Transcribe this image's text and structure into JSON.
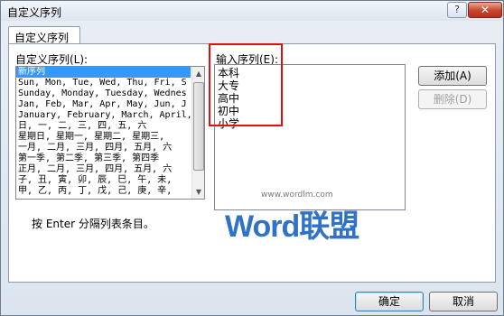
{
  "window": {
    "title": "自定义序列",
    "help_label": "?",
    "close_label": "✕"
  },
  "tab": {
    "label": "自定义序列"
  },
  "custom_list": {
    "label": "自定义序列(L):",
    "items": [
      "新序列",
      "Sun, Mon, Tue, Wed, Thu, Fri, S",
      "Sunday, Monday, Tuesday, Wednes",
      "Jan, Feb, Mar, Apr, May, Jun, J",
      "January, February, March, April,",
      "日, 一, 二, 三, 四, 五, 六",
      "星期日, 星期一, 星期二, 星期三,",
      "一月, 二月, 三月, 四月, 五月, 六",
      "第一季, 第二季, 第三季, 第四季",
      "正月, 二月, 三月, 四月, 五月, 六",
      "子, 丑, 寅, 卯, 辰, 巳, 午, 未,",
      "甲, 乙, 丙, 丁, 戊, 己, 庚, 辛,"
    ],
    "selected_index": 0
  },
  "input_entries": {
    "label": "输入序列(E):",
    "lines": [
      "本科",
      "大专",
      "高中",
      "初中",
      "小学"
    ]
  },
  "buttons": {
    "add": "添加(A)",
    "delete": "删除(D)",
    "ok": "确定",
    "cancel": "取消"
  },
  "hint": "按 Enter 分隔列表条目。",
  "watermark": {
    "url": "www.wordlm.com",
    "text": "Word联盟"
  },
  "colors": {
    "selection": "#3399ff",
    "highlight_box": "#e01010",
    "watermark": "#2f73c8"
  }
}
